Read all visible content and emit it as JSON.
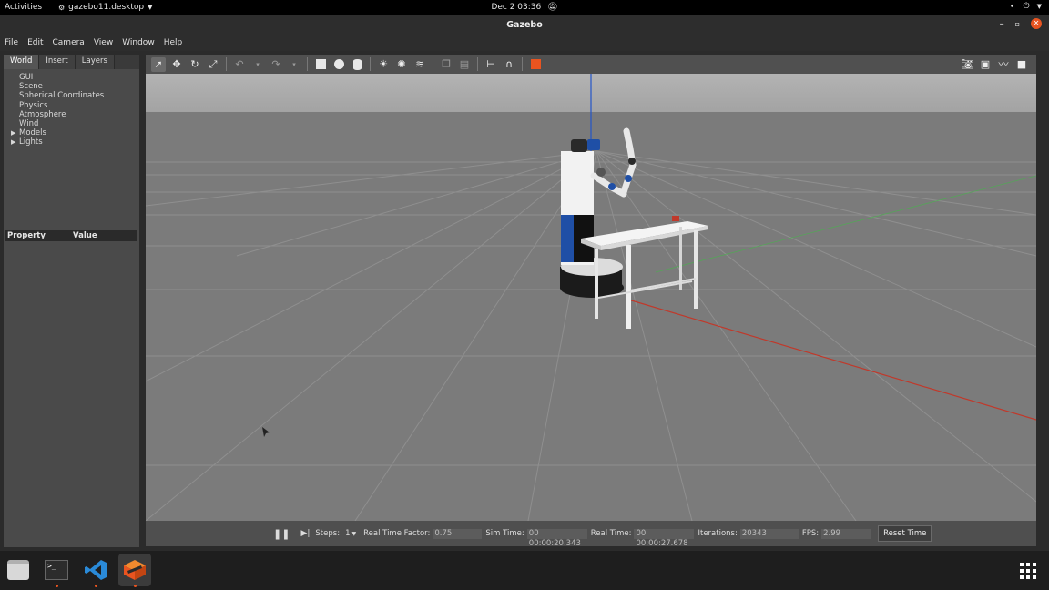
{
  "topbar": {
    "activities": "Activities",
    "app_menu": "gazebo11.desktop",
    "clock": "Dec 2  03:36"
  },
  "window": {
    "title": "Gazebo"
  },
  "menubar": [
    "File",
    "Edit",
    "Camera",
    "View",
    "Window",
    "Help"
  ],
  "left_panel": {
    "tabs": [
      "World",
      "Insert",
      "Layers"
    ],
    "tree": [
      "GUI",
      "Scene",
      "Spherical Coordinates",
      "Physics",
      "Atmosphere",
      "Wind",
      "Models",
      "Lights"
    ],
    "property_header": {
      "property": "Property",
      "value": "Value"
    }
  },
  "bottom_bar": {
    "steps_label": "Steps:",
    "steps_value": "1",
    "rtf_label": "Real Time Factor:",
    "rtf_value": "0.75",
    "sim_time_label": "Sim Time:",
    "sim_time_value": "00 00:00:20.343",
    "real_time_label": "Real Time:",
    "real_time_value": "00 00:00:27.678",
    "iterations_label": "Iterations:",
    "iterations_value": "20343",
    "fps_label": "FPS:",
    "fps_value": "2.99",
    "reset_label": "Reset Time"
  },
  "colors": {
    "accent": "#e95420",
    "ground": "#7a7a7a",
    "sky": "#a6a6a6",
    "axis_x": "#c0392b",
    "axis_y": "#4caf50",
    "axis_z": "#2455c8"
  }
}
